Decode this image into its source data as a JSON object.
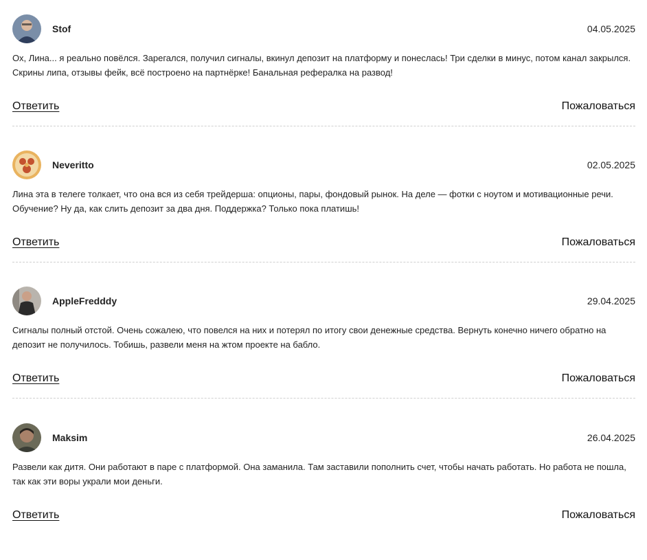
{
  "comments": [
    {
      "author": "Stof",
      "date": "04.05.2025",
      "text": "Ох, Лина... я реально повёлся. Зарегался, получил сигналы, вкинул депозит на платформу и понеслась! Три сделки в минус, потом канал закрылся. Скрины липа, отзывы фейк, всё построено на партнёрке! Банальная рефералка на развод!",
      "reply_label": "Ответить",
      "report_label": "Пожаловаться",
      "avatar_colors": {
        "bg": "#7a8ea8",
        "face": "#d9b8a0",
        "body": "#2f3e5c"
      }
    },
    {
      "author": "Neveritto",
      "date": "02.05.2025",
      "text": "Лина эта в телеге толкает, что она вся из себя трейдерша: опционы, пары, фондовый рынок. На деле — фотки с ноутом и мотивационные речи. Обучение? Ну да, как слить депозит за два дня. Поддержка? Только пока платишь!",
      "reply_label": "Ответить",
      "report_label": "Пожаловаться",
      "avatar_colors": {
        "bg": "#e9b35f",
        "face": "#c4522f",
        "body": "#f3d9a6"
      }
    },
    {
      "author": "AppleFredddy",
      "date": "29.04.2025",
      "text": "Сигналы полный отстой. Очень сожалею, что повелся на них и потерял по итогу свои денежные средства. Вернуть конечно ничего обратно на депозит не получилось. Тобишь, развели меня на жтом проекте на бабло.",
      "reply_label": "Ответить",
      "report_label": "Пожаловаться",
      "avatar_colors": {
        "bg": "#b9b4ad",
        "face": "#caa088",
        "body": "#2b2b2b"
      }
    },
    {
      "author": "Maksim",
      "date": "26.04.2025",
      "text": "Развели как дитя. Они работают в паре с платформой. Она заманила. Там заставили пополнить счет, чтобы начать работать. Но работа не пошла, так как эти воры украли мои деньги.",
      "reply_label": "Ответить",
      "report_label": "Пожаловаться",
      "avatar_colors": {
        "bg": "#6b6a58",
        "face": "#a9826a",
        "body": "#3a3d35"
      }
    }
  ]
}
